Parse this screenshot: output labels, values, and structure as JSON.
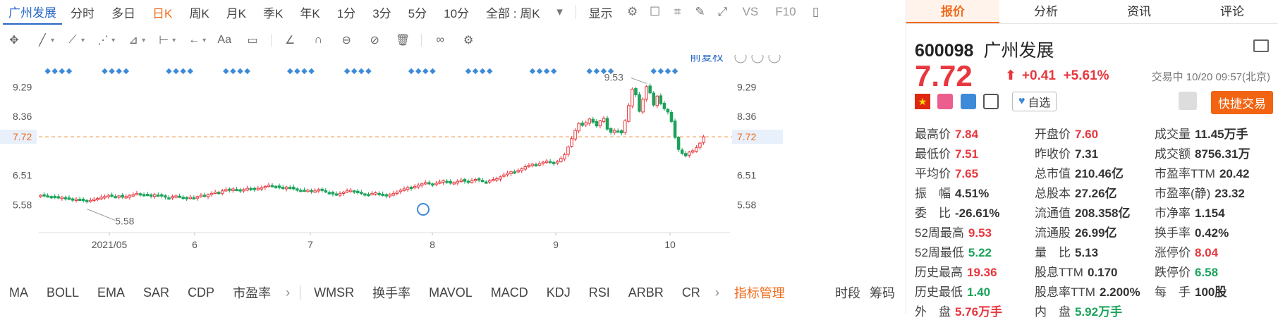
{
  "toolbar": {
    "stock_name": "广州发展",
    "periods": [
      "分时",
      "多日",
      "日K",
      "周K",
      "月K",
      "季K",
      "年K",
      "1分",
      "3分",
      "5分",
      "10分"
    ],
    "active_period": "日K",
    "all_selector": "全部 : 周K",
    "display_label": "显示",
    "vs_label": "VS",
    "f10_label": "F10"
  },
  "drawing_tools": [
    "cross-icon",
    "line-icon",
    "ray-icon",
    "wave-icon",
    "fib-icon",
    "measure-icon",
    "arrow-icon",
    "text-aa-icon",
    "comment-icon",
    "pen-icon",
    "magnet-icon",
    "eye-icon",
    "lock-icon",
    "trash-icon",
    "link-icon",
    "gear-icon"
  ],
  "text_aa": "Aa",
  "chart_header": {
    "restore_label": "前复权"
  },
  "chart_data": {
    "type": "candlestick",
    "y_ticks": [
      9.29,
      8.36,
      7.72,
      6.51,
      5.58
    ],
    "y_range": [
      4.75,
      9.85
    ],
    "x_labels": [
      "2021/05",
      "6",
      "7",
      "8",
      "9",
      "10"
    ],
    "current_price": 7.72,
    "high_marker": 9.53,
    "low_marker": 5.58,
    "closes": [
      5.88,
      5.87,
      5.86,
      5.84,
      5.82,
      5.8,
      5.82,
      5.78,
      5.76,
      5.74,
      5.76,
      5.74,
      5.72,
      5.7,
      5.72,
      5.76,
      5.78,
      5.82,
      5.84,
      5.88,
      5.86,
      5.84,
      5.86,
      5.82,
      5.84,
      5.88,
      5.9,
      5.94,
      5.92,
      5.9,
      5.88,
      5.86,
      5.9,
      5.88,
      5.86,
      5.82,
      5.8,
      5.84,
      5.86,
      5.84,
      5.8,
      5.78,
      5.82,
      5.8,
      5.84,
      5.88,
      5.86,
      5.9,
      5.94,
      5.98,
      5.96,
      6.02,
      6.06,
      6.04,
      6.08,
      6.04,
      6.02,
      6.06,
      6.1,
      6.08,
      6.06,
      6.1,
      6.12,
      6.16,
      6.2,
      6.18,
      6.16,
      6.12,
      6.1,
      6.14,
      6.12,
      6.08,
      6.06,
      6.04,
      6.02,
      6.04,
      6.0,
      6.02,
      6.06,
      6.04,
      5.98,
      5.96,
      5.92,
      5.9,
      5.94,
      5.98,
      6.02,
      6.04,
      6.0,
      5.96,
      5.94,
      5.92,
      5.9,
      5.94,
      5.96,
      5.92,
      5.88,
      5.86,
      5.9,
      5.94,
      5.98,
      6.04,
      6.08,
      6.12,
      6.1,
      6.16,
      6.2,
      6.24,
      6.28,
      6.26,
      6.22,
      6.26,
      6.3,
      6.34,
      6.3,
      6.26,
      6.28,
      6.32,
      6.36,
      6.32,
      6.3,
      6.34,
      6.38,
      6.36,
      6.32,
      6.3,
      6.34,
      6.38,
      6.4,
      6.46,
      6.52,
      6.58,
      6.62,
      6.6,
      6.66,
      6.72,
      6.78,
      6.82,
      6.86,
      6.84,
      6.88,
      6.92,
      6.96,
      6.92,
      6.88,
      6.94,
      7.04,
      7.16,
      7.4,
      7.66,
      7.92,
      8.14,
      8.08,
      8.16,
      8.28,
      8.18,
      8.06,
      8.22,
      8.3,
      7.96,
      7.86,
      7.92,
      7.9,
      7.84,
      8.22,
      8.7,
      9.22,
      9.04,
      8.52,
      8.9,
      9.3,
      9.1,
      8.72,
      9.0,
      8.76,
      8.6,
      8.5,
      8.2,
      7.7,
      7.32,
      7.2,
      7.12,
      7.24,
      7.28,
      7.38,
      7.52,
      7.72
    ]
  },
  "dot_labels_left": [
    "9.29",
    "8.36",
    "7.72",
    "6.51",
    "5.58"
  ],
  "indicators": {
    "items": [
      "MA",
      "BOLL",
      "EMA",
      "SAR",
      "CDP",
      "市盈率",
      "WMSR",
      "换手率",
      "MAVOL",
      "MACD",
      "KDJ",
      "RSI",
      "ARBR",
      "CR"
    ],
    "manage": "指标管理",
    "right_items": [
      "时段",
      "筹码"
    ]
  },
  "right_panel": {
    "tabs": [
      "报价",
      "分析",
      "资讯",
      "评论"
    ],
    "active_tab": "报价",
    "code": "600098",
    "name": "广州发展",
    "price": "7.72",
    "change": "+0.41",
    "pct": "+5.61%",
    "status_time": "交易中 10/20 09:57(北京)",
    "self_select": "自选",
    "quick_trade": "快捷交易",
    "stats": [
      [
        {
          "l": "最高价",
          "v": "7.84",
          "c": "red"
        },
        {
          "l": "开盘价",
          "v": "7.60",
          "c": "red"
        },
        {
          "l": "成交量",
          "v": "11.45万手",
          "c": "blk"
        }
      ],
      [
        {
          "l": "最低价",
          "v": "7.51",
          "c": "red"
        },
        {
          "l": "昨收价",
          "v": "7.31",
          "c": "blk"
        },
        {
          "l": "成交额",
          "v": "8756.31万",
          "c": "blk"
        }
      ],
      [
        {
          "l": "平均价",
          "v": "7.65",
          "c": "red"
        },
        {
          "l": "总市值",
          "v": "210.46亿",
          "c": "blk"
        },
        {
          "l": "市盈率TTM",
          "v": "20.42",
          "c": "blk"
        }
      ],
      [
        {
          "l": "振　幅",
          "v": "4.51%",
          "c": "blk"
        },
        {
          "l": "总股本",
          "v": "27.26亿",
          "c": "blk"
        },
        {
          "l": "市盈率(静)",
          "v": "23.32",
          "c": "blk"
        }
      ],
      [
        {
          "l": "委　比",
          "v": "-26.61%",
          "c": "blk"
        },
        {
          "l": "流通值",
          "v": "208.358亿",
          "c": "blk"
        },
        {
          "l": "市净率",
          "v": "1.154",
          "c": "blk"
        }
      ],
      [
        {
          "l": "52周最高",
          "v": "9.53",
          "c": "red"
        },
        {
          "l": "流通股",
          "v": "26.99亿",
          "c": "blk"
        },
        {
          "l": "换手率",
          "v": "0.42%",
          "c": "blk"
        }
      ],
      [
        {
          "l": "52周最低",
          "v": "5.22",
          "c": "grn"
        },
        {
          "l": "量　比",
          "v": "5.13",
          "c": "blk"
        },
        {
          "l": "涨停价",
          "v": "8.04",
          "c": "red"
        }
      ],
      [
        {
          "l": "历史最高",
          "v": "19.36",
          "c": "red"
        },
        {
          "l": "股息TTM",
          "v": "0.170",
          "c": "blk"
        },
        {
          "l": "跌停价",
          "v": "6.58",
          "c": "grn"
        }
      ],
      [
        {
          "l": "历史最低",
          "v": "1.40",
          "c": "grn"
        },
        {
          "l": "股息率TTM",
          "v": "2.200%",
          "c": "blk"
        },
        {
          "l": "每　手",
          "v": "100股",
          "c": "blk"
        }
      ],
      [
        {
          "l": "外　盘",
          "v": "5.76万手",
          "c": "red"
        },
        {
          "l": "内　盘",
          "v": "5.92万手",
          "c": "grn"
        },
        {
          "l": "",
          "v": "",
          "c": "blk"
        }
      ]
    ]
  }
}
